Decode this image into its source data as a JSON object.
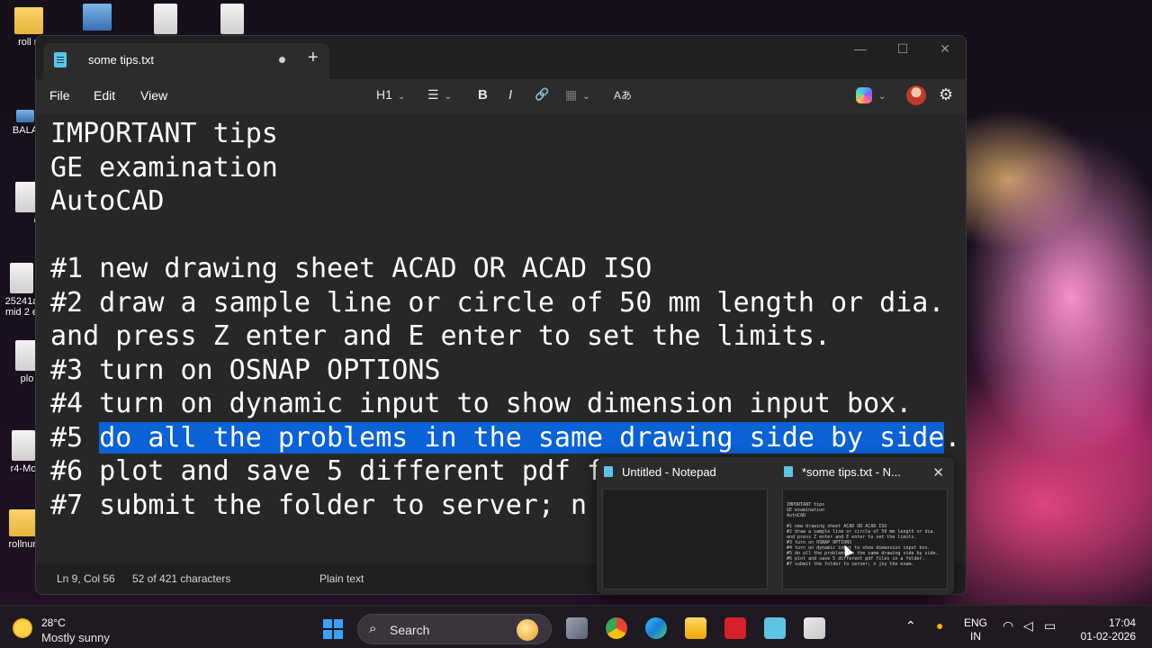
{
  "desktop": {
    "icons": [
      {
        "label": "roll n",
        "icon": "folder-icon"
      },
      {
        "label": "",
        "icon": "computer-icon"
      },
      {
        "label": "",
        "icon": "document-icon"
      },
      {
        "label": "",
        "icon": "document-icon"
      },
      {
        "label": "BALA",
        "icon": "app-icon"
      },
      {
        "label": "qn",
        "icon": "document-icon"
      },
      {
        "label": "25241a",
        "label2": "mid 2 e",
        "icon": "document-icon"
      },
      {
        "label": "plo",
        "icon": "document-icon"
      },
      {
        "label": "r4-Mo",
        "icon": "document-icon"
      },
      {
        "label": "rollnun",
        "icon": "folder-icon"
      }
    ]
  },
  "notepad": {
    "tab_title": "some tips.txt",
    "unsaved_indicator": "●",
    "new_tab_label": "+",
    "window_controls": {
      "minimize": "—",
      "maximize": "☐",
      "close": "✕"
    },
    "menu": {
      "file": "File",
      "edit": "Edit",
      "view": "View"
    },
    "toolbar": {
      "heading": "H1",
      "list": "☰",
      "bold": "B",
      "italic": "I",
      "link": "🔗",
      "table": "▦",
      "spellcheck": "Aあ"
    },
    "lines": [
      "IMPORTANT tips",
      "GE examination",
      "AutoCAD",
      "",
      "#1 new drawing sheet ACAD OR ACAD ISO",
      "#2 draw a sample line or circle of 50 mm length or dia.",
      "and press Z enter and E enter to set the limits.",
      "#3 turn on OSNAP OPTIONS",
      "#4 turn on dynamic input to show dimension input box."
    ],
    "line5": {
      "prefix": "#5 ",
      "selected": "do all the problems in the same drawing side by side",
      "suffix": "."
    },
    "line6_visible": "#6 plot and save 5 different pdf f",
    "line7_visible": "#7 submit the folder to server; n",
    "status": {
      "position": "Ln 9, Col 56",
      "selection": "52 of 421 characters",
      "format": "Plain text"
    }
  },
  "preview": {
    "items": [
      {
        "title": "Untitled - Notepad"
      },
      {
        "title": "*some tips.txt - N..."
      }
    ],
    "close": "✕",
    "mini_text": "IMPORTANT tips\nGE examination\nAutoCAD\n\n#1 new drawing sheet ACAD OR ACAD ISO\n#2 draw a sample line or circle of 50 mm length or dia.\nand press Z enter and E enter to set the limits.\n#3 turn on OSNAP OPTIONS\n#4 turn on dynamic input to show dimension input box.\n#5 do all the problems in the same drawing side by side.\n#6 plot and save 5 different pdf files in a folder.\n#7 submit the folder to server; n joy the exam."
  },
  "taskbar": {
    "weather": {
      "temp": "28°C",
      "condition": "Mostly sunny"
    },
    "search_label": "Search",
    "tray": {
      "lang_line1": "ENG",
      "lang_line2": "IN",
      "time": "17:04",
      "date": "01-02-2026"
    }
  }
}
